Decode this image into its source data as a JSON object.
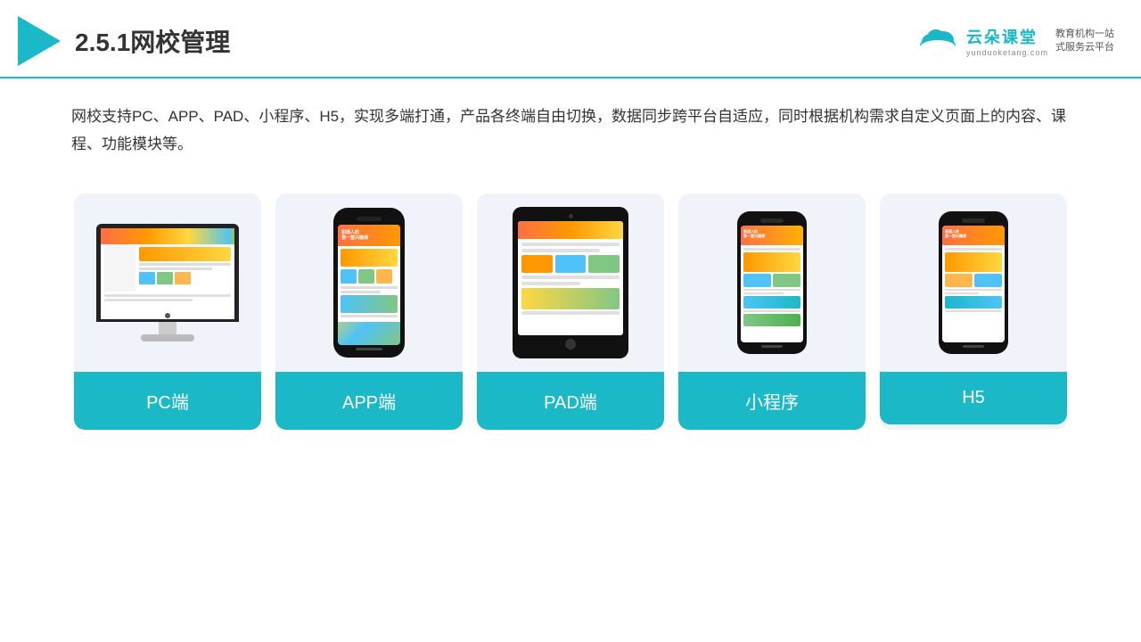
{
  "header": {
    "title": "2.5.1网校管理",
    "brand": {
      "name_cn": "云朵课堂",
      "name_en": "yunduoketang.com",
      "tagline_line1": "教育机构一站",
      "tagline_line2": "式服务云平台"
    }
  },
  "description": "网校支持PC、APP、PAD、小程序、H5，实现多端打通，产品各终端自由切换，数据同步跨平台自适应，同时根据机构需求自定义页面上的内容、课程、功能模块等。",
  "cards": [
    {
      "id": "pc",
      "label": "PC端"
    },
    {
      "id": "app",
      "label": "APP端"
    },
    {
      "id": "pad",
      "label": "PAD端"
    },
    {
      "id": "miniprogram",
      "label": "小程序"
    },
    {
      "id": "h5",
      "label": "H5"
    }
  ],
  "colors": {
    "accent": "#1bb8c8",
    "card_bg": "#eef2fa",
    "label_bg": "#1bb8c8",
    "text_dark": "#333333"
  }
}
